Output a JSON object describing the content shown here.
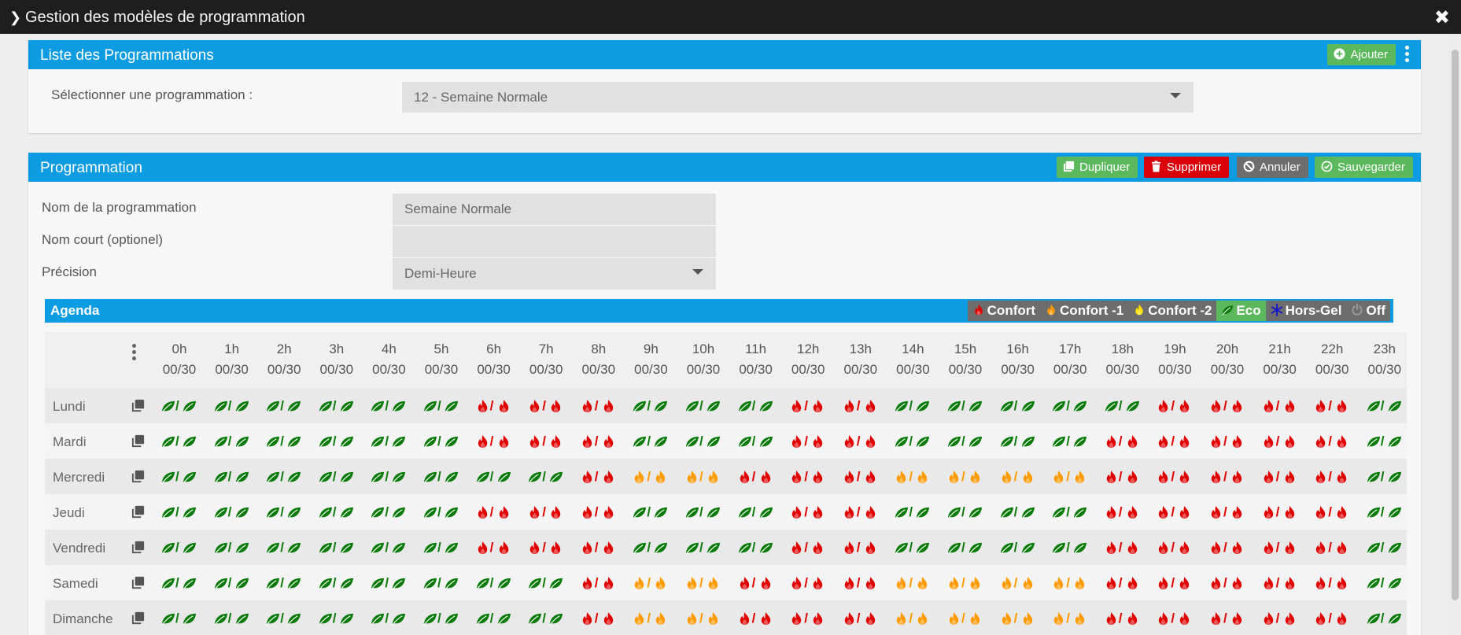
{
  "window": {
    "title": "Gestion des modèles de programmation"
  },
  "list_panel": {
    "title": "Liste des Programmations",
    "add_label": "Ajouter",
    "select_label": "Sélectionner une programmation :",
    "select_value": "12 - Semaine Normale"
  },
  "prog_panel": {
    "title": "Programmation",
    "buttons": {
      "duplicate": "Dupliquer",
      "delete": "Supprimer",
      "cancel": "Annuler",
      "save": "Sauvegarder"
    },
    "fields": {
      "name_label": "Nom de la programmation",
      "name_value": "Semaine Normale",
      "short_label": "Nom court (optionel)",
      "short_value": "",
      "precision_label": "Précision",
      "precision_value": "Demi-Heure"
    }
  },
  "agenda": {
    "title": "Agenda",
    "legend": [
      {
        "key": "C",
        "label": "Confort",
        "icon": "flame-icon",
        "color": "#e00000",
        "bg": "#6d6d6d"
      },
      {
        "key": "C1",
        "label": "Confort -1",
        "icon": "flame-icon",
        "color": "#ff9a00",
        "bg": "#6d6d6d"
      },
      {
        "key": "C2",
        "label": "Confort -2",
        "icon": "flame-icon",
        "color": "#ffe000",
        "bg": "#6d6d6d"
      },
      {
        "key": "E",
        "label": "Eco",
        "icon": "leaf-icon",
        "color": "#0a7a0a",
        "bg": "#5cb85c"
      },
      {
        "key": "H",
        "label": "Hors-Gel",
        "icon": "snowflake-icon",
        "color": "#1010d0",
        "bg": "#6d6d6d"
      },
      {
        "key": "O",
        "label": "Off",
        "icon": "power-icon",
        "color": "#9a9a9a",
        "bg": "#6d6d6d"
      }
    ],
    "hours": [
      "0h",
      "1h",
      "2h",
      "3h",
      "4h",
      "5h",
      "6h",
      "7h",
      "8h",
      "9h",
      "10h",
      "11h",
      "12h",
      "13h",
      "14h",
      "15h",
      "16h",
      "17h",
      "18h",
      "19h",
      "20h",
      "21h",
      "22h",
      "23h"
    ],
    "half_label": "00/30",
    "days": [
      {
        "name": "Lundi",
        "slots": [
          "E",
          "E",
          "E",
          "E",
          "E",
          "E",
          "C",
          "C",
          "C",
          "E",
          "E",
          "E",
          "C",
          "C",
          "E",
          "E",
          "E",
          "E",
          "E",
          "C",
          "C",
          "C",
          "C",
          "E"
        ]
      },
      {
        "name": "Mardi",
        "slots": [
          "E",
          "E",
          "E",
          "E",
          "E",
          "E",
          "C",
          "C",
          "C",
          "E",
          "E",
          "E",
          "C",
          "C",
          "E",
          "E",
          "E",
          "E",
          "C",
          "C",
          "C",
          "C",
          "C",
          "E"
        ]
      },
      {
        "name": "Mercredi",
        "slots": [
          "E",
          "E",
          "E",
          "E",
          "E",
          "E",
          "E",
          "E",
          "C",
          "C1",
          "C1",
          "C",
          "C",
          "C",
          "C1",
          "C1",
          "C1",
          "C1",
          "C",
          "C",
          "C",
          "C",
          "C",
          "E"
        ]
      },
      {
        "name": "Jeudi",
        "slots": [
          "E",
          "E",
          "E",
          "E",
          "E",
          "E",
          "C",
          "C",
          "C",
          "E",
          "E",
          "E",
          "C",
          "C",
          "E",
          "E",
          "E",
          "E",
          "C",
          "C",
          "C",
          "C",
          "C",
          "E"
        ]
      },
      {
        "name": "Vendredi",
        "slots": [
          "E",
          "E",
          "E",
          "E",
          "E",
          "E",
          "C",
          "C",
          "C",
          "E",
          "E",
          "E",
          "C",
          "C",
          "E",
          "E",
          "E",
          "E",
          "C",
          "C",
          "C",
          "C",
          "C",
          "E"
        ]
      },
      {
        "name": "Samedi",
        "slots": [
          "E",
          "E",
          "E",
          "E",
          "E",
          "E",
          "E",
          "E",
          "C",
          "C1",
          "C1",
          "C",
          "C",
          "C",
          "C1",
          "C1",
          "C1",
          "C1",
          "C",
          "C",
          "C",
          "C",
          "C",
          "E"
        ]
      },
      {
        "name": "Dimanche",
        "slots": [
          "E",
          "E",
          "E",
          "E",
          "E",
          "E",
          "E",
          "E",
          "C",
          "C1",
          "C1",
          "C",
          "C",
          "C",
          "C1",
          "C1",
          "C1",
          "C1",
          "C",
          "C",
          "C",
          "C",
          "C",
          "E"
        ]
      }
    ]
  }
}
